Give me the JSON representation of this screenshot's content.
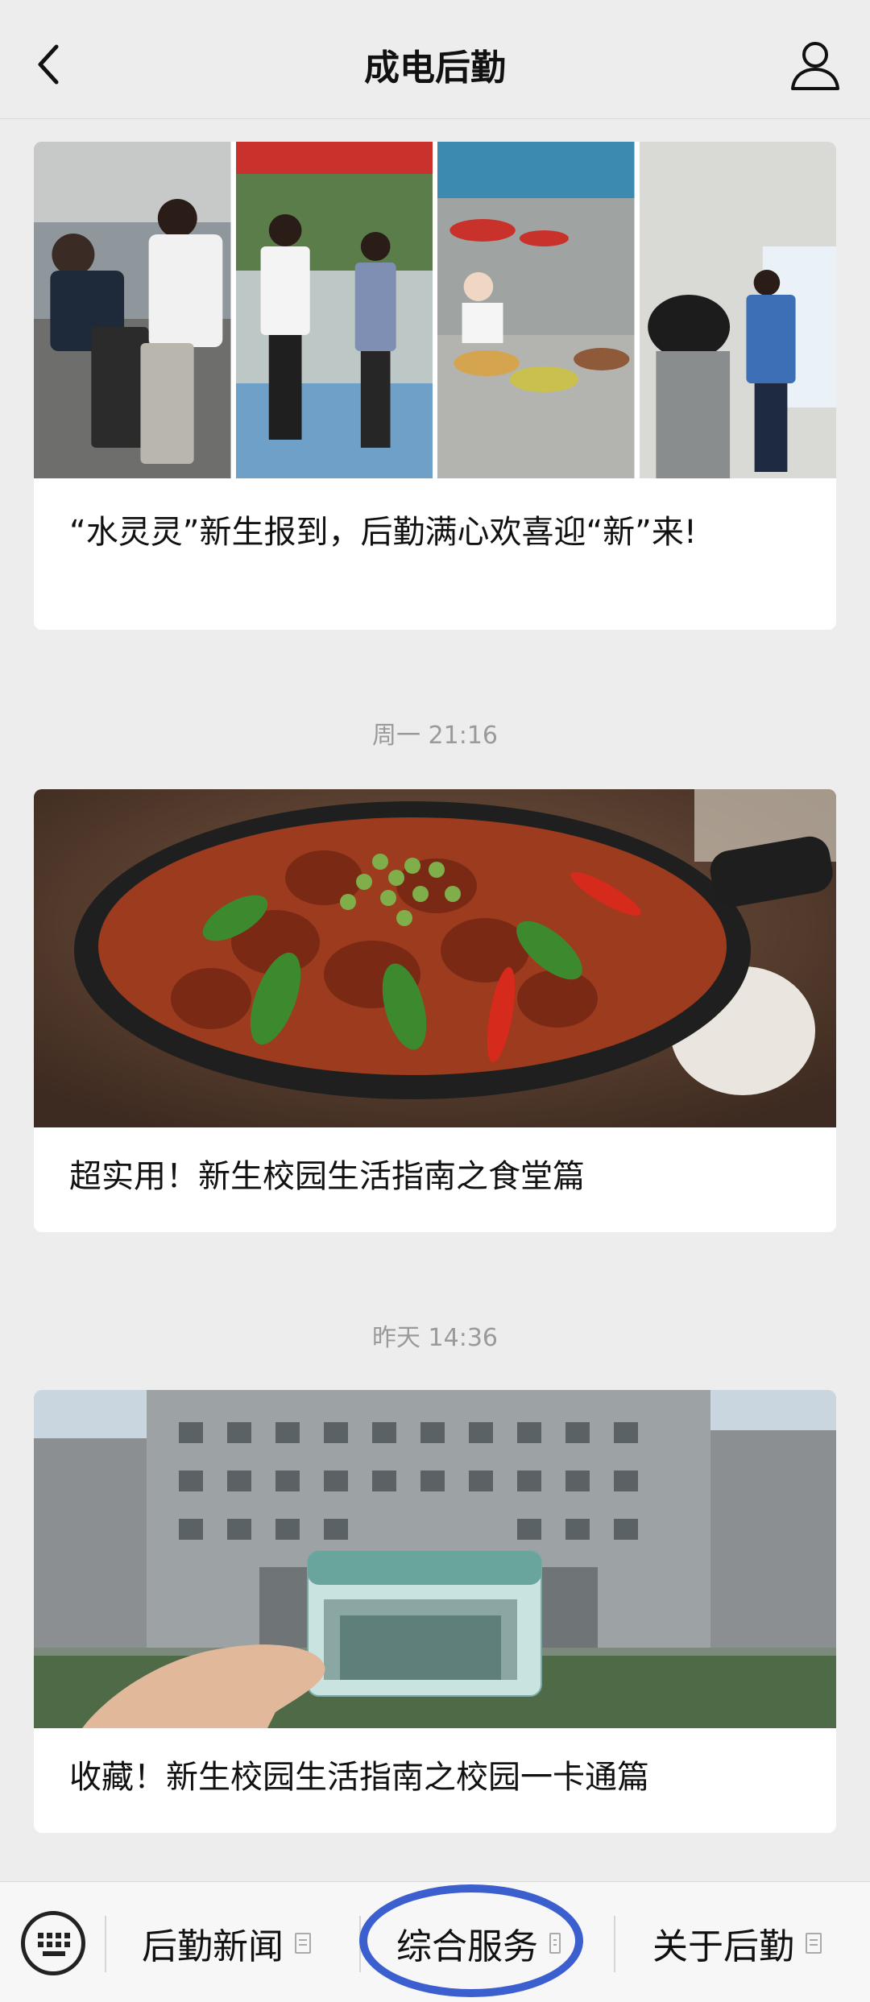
{
  "header": {
    "title": "成电后勤",
    "back_icon": "chevron-left-icon",
    "user_icon": "user-icon"
  },
  "articles": [
    {
      "title": "“水灵灵”新生报到，后勤满心欢喜迎“新”来!",
      "image": "photo-collage-freshmen-checkin"
    },
    {
      "timestamp": "周一 21:16",
      "title": "超实用！新生校园生活指南之食堂篇",
      "image": "photo-spicy-chicken-dish"
    },
    {
      "timestamp": "昨天 14:36",
      "title": "收藏！新生校园生活指南之校园一卡通篇",
      "image": "photo-campus-card-building"
    }
  ],
  "bottom_menu": {
    "keyboard_icon": "keyboard-icon",
    "items": [
      {
        "label": "后勤新闻"
      },
      {
        "label": "综合服务"
      },
      {
        "label": "关于后勤"
      }
    ],
    "highlight_color": "#3b5fcf"
  }
}
